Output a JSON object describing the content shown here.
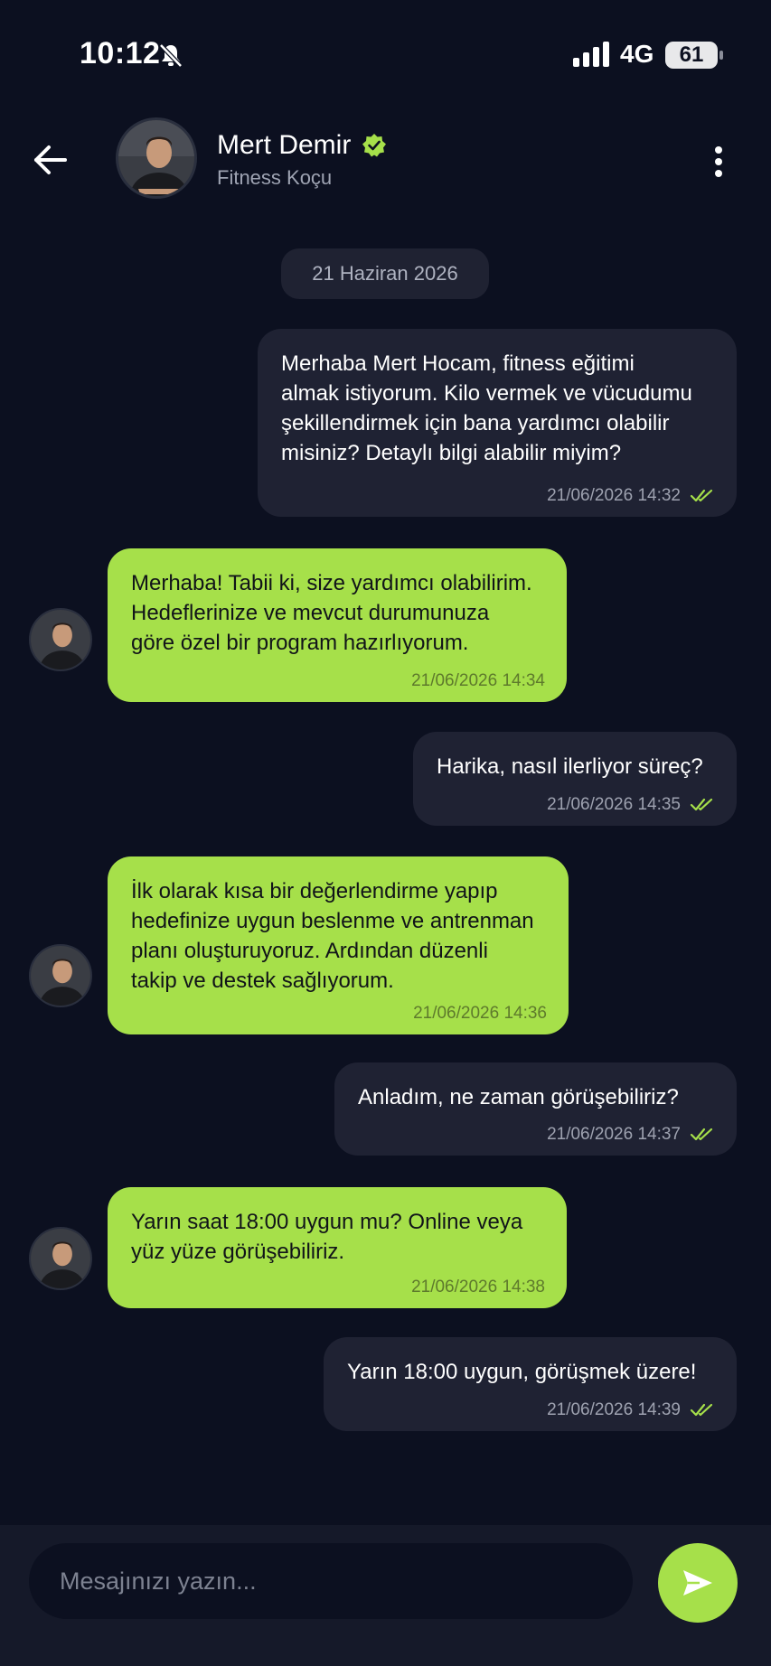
{
  "status_bar": {
    "time": "10:12",
    "network": "4G",
    "battery": "61",
    "icons": [
      "bell-off-icon",
      "signal-icon"
    ]
  },
  "header": {
    "name": "Mert Demir",
    "subtitle": "Fitness Koçu",
    "verified": true,
    "icons": [
      "back-arrow-icon",
      "verified-icon",
      "more-vertical-icon"
    ]
  },
  "date_separator": "21 Haziran 2026",
  "messages": [
    {
      "direction": "out",
      "text": "Merhaba Mert Hocam, fitness eğitimi\nalmak istiyorum. Kilo vermek ve vücudumu\nşekillendirmek için bana yardımcı olabilir\nmisiniz? Detaylı bilgi alabilir miyim?",
      "time": "21/06/2026 14:32",
      "read": true
    },
    {
      "direction": "in",
      "text": "Merhaba! Tabii ki, size yardımcı olabilirim.\nHedeflerinize ve mevcut durumunuza\ngöre özel bir program hazırlıyorum.",
      "time": "21/06/2026 14:34"
    },
    {
      "direction": "out",
      "text": "Harika, nasıl ilerliyor süreç?",
      "time": "21/06/2026 14:35",
      "read": true
    },
    {
      "direction": "in",
      "text": "İlk olarak kısa bir değerlendirme yapıp\nhedefinize uygun beslenme ve antrenman\nplanı oluşturuyoruz. Ardından düzenli\ntakip ve destek sağlıyorum.",
      "time": "21/06/2026 14:36"
    },
    {
      "direction": "out",
      "text": "Anladım, ne zaman görüşebiliriz?",
      "time": "21/06/2026 14:37",
      "read": true
    },
    {
      "direction": "in",
      "text": "Yarın saat 18:00 uygun mu? Online veya\nyüz yüze görüşebiliriz.",
      "time": "21/06/2026 14:38"
    },
    {
      "direction": "out",
      "text": "Yarın 18:00 uygun, görüşmek üzere!",
      "time": "21/06/2026 14:39",
      "read": true
    }
  ],
  "composer": {
    "placeholder": "Mesajınızı yazın...",
    "send_icon": "send-icon"
  },
  "colors": {
    "background": "#0c1020",
    "outgoing_bubble": "#1f2233",
    "incoming_bubble": "#a6e04a",
    "accent": "#a6e04a",
    "read_tick": "#a6e04a"
  }
}
